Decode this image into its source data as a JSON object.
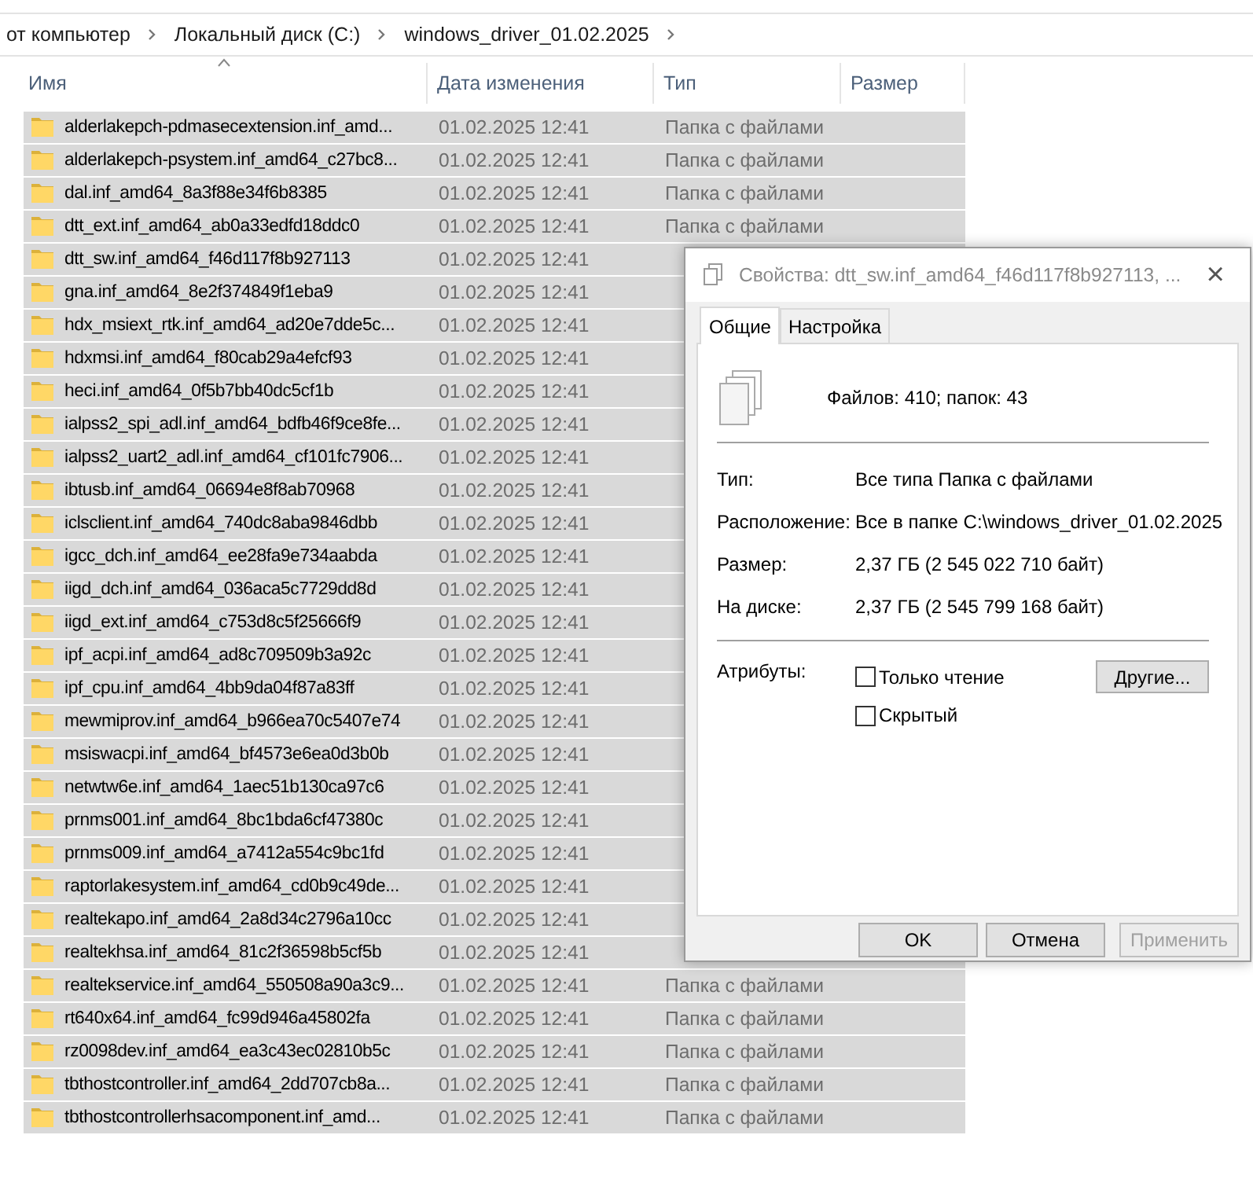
{
  "breadcrumb": [
    "от компьютер",
    "Локальный диск (C:)",
    "windows_driver_01.02.2025"
  ],
  "columns": [
    "Имя",
    "Дата изменения",
    "Тип",
    "Размер"
  ],
  "rows": [
    {
      "name": "alderlakepch-pdmasecextension.inf_amd...",
      "date": "01.02.2025 12:41",
      "type": "Папка с файлами",
      "selected": true
    },
    {
      "name": "alderlakepch-psystem.inf_amd64_c27bc8...",
      "date": "01.02.2025 12:41",
      "type": "Папка с файлами",
      "selected": true
    },
    {
      "name": "dal.inf_amd64_8a3f88e34f6b8385",
      "date": "01.02.2025 12:41",
      "type": "Папка с файлами",
      "selected": true
    },
    {
      "name": "dtt_ext.inf_amd64_ab0a33edfd18ddc0",
      "date": "01.02.2025 12:41",
      "type": "Папка с файлами",
      "selected": true
    },
    {
      "name": "dtt_sw.inf_amd64_f46d117f8b927113",
      "date": "01.02.2025 12:41",
      "selected": true
    },
    {
      "name": "gna.inf_amd64_8e2f374849f1eba9",
      "date": "01.02.2025 12:41",
      "selected": true
    },
    {
      "name": "hdx_msiext_rtk.inf_amd64_ad20e7dde5c...",
      "date": "01.02.2025 12:41",
      "selected": true
    },
    {
      "name": "hdxmsi.inf_amd64_f80cab29a4efcf93",
      "date": "01.02.2025 12:41",
      "selected": true
    },
    {
      "name": "heci.inf_amd64_0f5b7bb40dc5cf1b",
      "date": "01.02.2025 12:41",
      "selected": true
    },
    {
      "name": "ialpss2_spi_adl.inf_amd64_bdfb46f9ce8fe...",
      "date": "01.02.2025 12:41",
      "selected": true
    },
    {
      "name": "ialpss2_uart2_adl.inf_amd64_cf101fc7906...",
      "date": "01.02.2025 12:41",
      "selected": true
    },
    {
      "name": "ibtusb.inf_amd64_06694e8f8ab70968",
      "date": "01.02.2025 12:41",
      "selected": true
    },
    {
      "name": "iclsclient.inf_amd64_740dc8aba9846dbb",
      "date": "01.02.2025 12:41",
      "selected": true
    },
    {
      "name": "igcc_dch.inf_amd64_ee28fa9e734aabda",
      "date": "01.02.2025 12:41",
      "selected": true
    },
    {
      "name": "iigd_dch.inf_amd64_036aca5c7729dd8d",
      "date": "01.02.2025 12:41",
      "selected": true
    },
    {
      "name": "iigd_ext.inf_amd64_c753d8c5f25666f9",
      "date": "01.02.2025 12:41",
      "selected": true
    },
    {
      "name": "ipf_acpi.inf_amd64_ad8c709509b3a92c",
      "date": "01.02.2025 12:41",
      "selected": true
    },
    {
      "name": "ipf_cpu.inf_amd64_4bb9da04f87a83ff",
      "date": "01.02.2025 12:41",
      "selected": true
    },
    {
      "name": "mewmiprov.inf_amd64_b966ea70c5407e74",
      "date": "01.02.2025 12:41",
      "selected": true
    },
    {
      "name": "msiswacpi.inf_amd64_bf4573e6ea0d3b0b",
      "date": "01.02.2025 12:41",
      "selected": true
    },
    {
      "name": "netwtw6e.inf_amd64_1aec51b130ca97c6",
      "date": "01.02.2025 12:41",
      "selected": true
    },
    {
      "name": "prnms001.inf_amd64_8bc1bda6cf47380c",
      "date": "01.02.2025 12:41",
      "selected": true
    },
    {
      "name": "prnms009.inf_amd64_a7412a554c9bc1fd",
      "date": "01.02.2025 12:41",
      "selected": true
    },
    {
      "name": "raptorlakesystem.inf_amd64_cd0b9c49de...",
      "date": "01.02.2025 12:41",
      "selected": true
    },
    {
      "name": "realtekapo.inf_amd64_2a8d34c2796a10cc",
      "date": "01.02.2025 12:41",
      "selected": true
    },
    {
      "name": "realtekhsa.inf_amd64_81c2f36598b5cf5b",
      "date": "01.02.2025 12:41",
      "selected": true
    },
    {
      "name": "realtekservice.inf_amd64_550508a90a3c9...",
      "date": "01.02.2025 12:41",
      "type": "Папка с файлами",
      "selected": true
    },
    {
      "name": "rt640x64.inf_amd64_fc99d946a45802fa",
      "date": "01.02.2025 12:41",
      "type": "Папка с файлами",
      "selected": true
    },
    {
      "name": "rz0098dev.inf_amd64_ea3c43ec02810b5c",
      "date": "01.02.2025 12:41",
      "type": "Папка с файлами",
      "selected": true
    },
    {
      "name": "tbthostcontroller.inf_amd64_2dd707cb8a...",
      "date": "01.02.2025 12:41",
      "type": "Папка с файлами",
      "selected": true
    },
    {
      "name": "tbthostcontrollerhsacomponent.inf_amd...",
      "date": "01.02.2025 12:41",
      "type": "Папка с файлами",
      "selected": true
    }
  ],
  "dialog": {
    "title": "Свойства: dtt_sw.inf_amd64_f46d117f8b927113, ...",
    "close": "×",
    "tabs": [
      {
        "label": "Общие",
        "selected": true
      },
      {
        "label": "Настройка",
        "selected": false
      }
    ],
    "summary": "Файлов: 410; папок: 43",
    "properties": [
      {
        "label": "Тип:",
        "value": "Все типа Папка с файлами"
      },
      {
        "label": "Расположение:",
        "value": "Все в папке C:\\windows_driver_01.02.2025"
      },
      {
        "label": "Размер:",
        "value": "2,37 ГБ (2 545 022 710 байт)"
      },
      {
        "label": "На диске:",
        "value": "2,37 ГБ (2 545 799 168 байт)"
      }
    ],
    "attributes_label": "Атрибуты:",
    "attributes": [
      {
        "label": "Только чтение",
        "checked": false
      },
      {
        "label": "Скрытый",
        "checked": false
      }
    ],
    "advanced_button": "Другие...",
    "buttons": [
      {
        "label": "OK",
        "disabled": false
      },
      {
        "label": "Отмена",
        "disabled": false
      },
      {
        "label": "Применить",
        "disabled": true
      }
    ]
  }
}
